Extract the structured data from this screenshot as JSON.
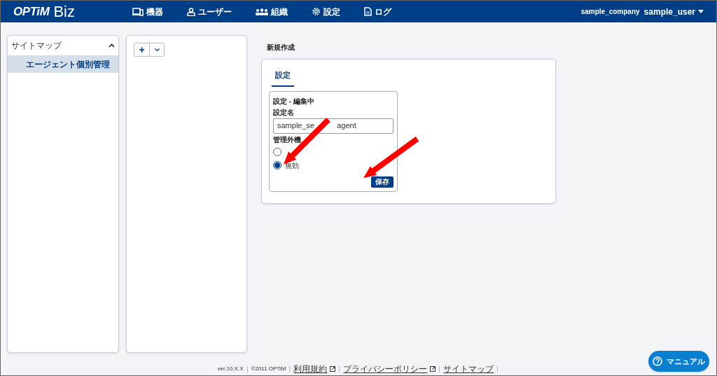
{
  "header": {
    "logo": "OPTiM",
    "logo_suffix": "Biz",
    "nav": [
      {
        "kind": "device",
        "label": "機器"
      },
      {
        "kind": "user",
        "label": "ユーザー"
      },
      {
        "kind": "org",
        "label": "組織"
      },
      {
        "kind": "gear",
        "label": "設定"
      },
      {
        "kind": "log",
        "label": "ログ"
      }
    ],
    "company": "sample_company",
    "user": "sample_user"
  },
  "sidebar": {
    "title": "サイトマップ",
    "expanded": true,
    "items": [
      {
        "label": "エージェント個別管理",
        "selected": true
      }
    ]
  },
  "toolbar": {
    "add": "+"
  },
  "page_title": "新規作成",
  "tabs": [
    {
      "label": "設定",
      "selected": true
    }
  ],
  "form": {
    "title": "設定 - 編集中",
    "name_label": "設定名",
    "name_value_parts": [
      "sample_se",
      "agent"
    ],
    "group_label": "管理外機",
    "radios": [
      {
        "selected": false
      },
      {
        "label": "無効",
        "selected": true
      }
    ],
    "save": "保存"
  },
  "footer": [
    "ver.10.X.X",
    "©2011 OPTiM",
    "利用規約",
    "プライバシーポリシー",
    "サイトマップ"
  ],
  "manual_button": "マニュアル"
}
